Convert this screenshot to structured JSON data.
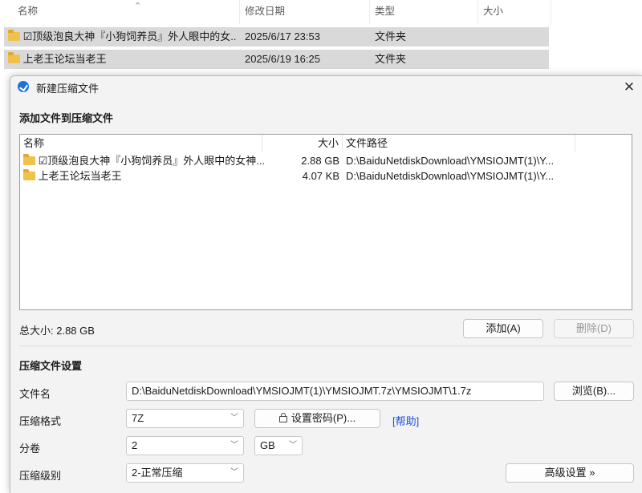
{
  "explorer": {
    "columns": [
      "名称",
      "修改日期",
      "类型",
      "大小"
    ],
    "rows": [
      {
        "name": "☑顶级泡良大神『小狗饲养员』外人眼中的女...",
        "date": "2025/6/17 23:53",
        "type": "文件夹",
        "size": ""
      },
      {
        "name": "上老王论坛当老王",
        "date": "2025/6/19 16:25",
        "type": "文件夹",
        "size": ""
      }
    ]
  },
  "dialog": {
    "title": "新建压缩文件",
    "add_section_title": "添加文件到压缩文件",
    "list_columns": {
      "name": "名称",
      "size": "大小",
      "path": "文件路径"
    },
    "files": [
      {
        "name": "☑顶级泡良大神『小狗饲养员』外人眼中的女神...",
        "size": "2.88 GB",
        "path": "D:\\BaiduNetdiskDownload\\YMSIOJMT(1)\\Y..."
      },
      {
        "name": "上老王论坛当老王",
        "size": "4.07 KB",
        "path": "D:\\BaiduNetdiskDownload\\YMSIOJMT(1)\\Y..."
      }
    ],
    "total_size": "总大小: 2.88 GB",
    "add_button": "添加(A)",
    "delete_button": "删除(D)",
    "settings_title": "压缩文件设置",
    "filename_label": "文件名",
    "filename_value": "D:\\BaiduNetdiskDownload\\YMSIOJMT(1)\\YMSIOJMT.7z\\YMSIOJMT\\1.7z",
    "browse_button": "浏览(B)...",
    "format_label": "压缩格式",
    "format_value": "7Z",
    "password_button": "设置密码(P)...",
    "help_link": "[帮助]",
    "split_label": "分卷",
    "split_value": "2",
    "split_unit": "GB",
    "level_label": "压缩级别",
    "level_value": "2-正常压缩",
    "advanced_button": "高级设置 »"
  }
}
